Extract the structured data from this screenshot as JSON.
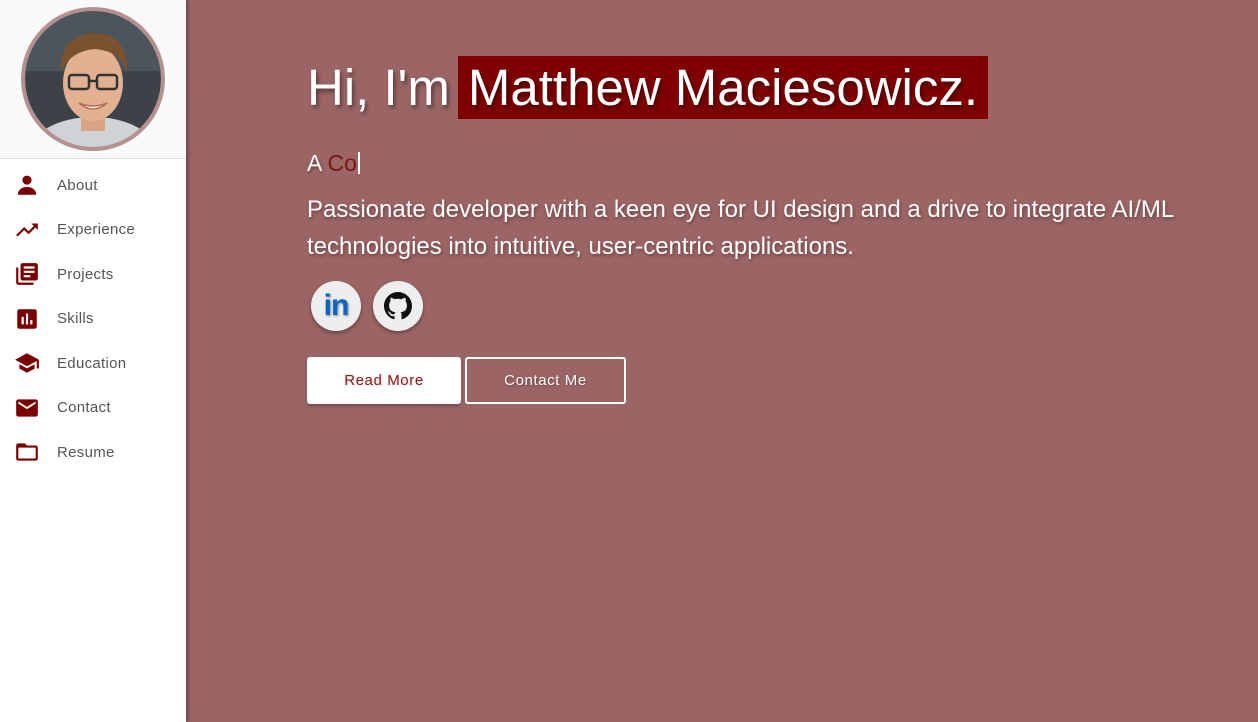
{
  "sidebar": {
    "items": [
      {
        "label": "About",
        "icon": "person-icon"
      },
      {
        "label": "Experience",
        "icon": "trending-up-icon"
      },
      {
        "label": "Projects",
        "icon": "library-icon"
      },
      {
        "label": "Skills",
        "icon": "bar-chart-icon"
      },
      {
        "label": "Education",
        "icon": "graduation-cap-icon"
      },
      {
        "label": "Contact",
        "icon": "mail-icon"
      },
      {
        "label": "Resume",
        "icon": "folder-icon"
      }
    ]
  },
  "hero": {
    "greeting": "Hi, I'm",
    "name": "Matthew Maciesowicz.",
    "tagline_prefix": "A",
    "tagline_typed": "Co",
    "description": "Passionate developer with a keen eye for UI design and a drive to integrate AI/ML technologies into intuitive, user-centric applications."
  },
  "socials": [
    {
      "name": "linkedin",
      "text": "in"
    },
    {
      "name": "github"
    }
  ],
  "buttons": {
    "read_more": "Read More",
    "contact_me": "Contact Me"
  },
  "colors": {
    "accent": "#7f0000",
    "background": "#9c6565",
    "sidebar": "#ffffff"
  }
}
